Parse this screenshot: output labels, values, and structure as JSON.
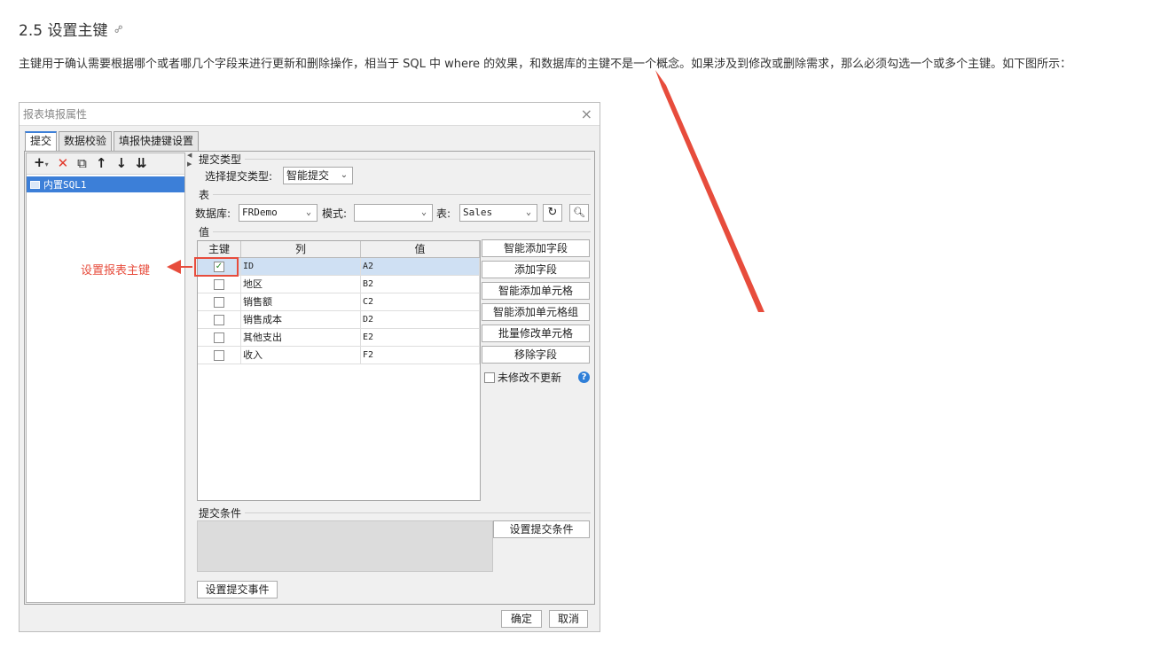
{
  "doc": {
    "section_title": "2.5 设置主键",
    "paragraph": "主键用于确认需要根据哪个或者哪几个字段来进行更新和删除操作，相当于 SQL 中 where 的效果，和数据库的主键不是一个概念。如果涉及到修改或删除需求，那么必须勾选一个或多个主键。如下图所示："
  },
  "annotation": {
    "label": "设置报表主键",
    "color": "#e74c3c"
  },
  "dialog": {
    "title": "报表填报属性",
    "close": "×",
    "tabs": [
      {
        "label": "提交",
        "active": true
      },
      {
        "label": "数据校验",
        "active": false
      },
      {
        "label": "填报快捷键设置",
        "active": false
      }
    ],
    "toolbar": {
      "add": "+",
      "add_dd": "▾",
      "delete": "✕",
      "copy": "⧉",
      "up": "↑",
      "down": "↓",
      "bottom": "⇊"
    },
    "tree": {
      "item": "内置SQL1"
    },
    "submit_type": {
      "section": "提交类型",
      "label": "选择提交类型:",
      "value": "智能提交"
    },
    "table": {
      "section": "表",
      "db_label": "数据库:",
      "db_value": "FRDemo",
      "schema_label": "模式:",
      "schema_value": "",
      "table_label": "表:",
      "table_value": "Sales"
    },
    "values": {
      "section": "值",
      "headers": {
        "pk": "主键",
        "col": "列",
        "val": "值"
      },
      "rows": [
        {
          "pk": true,
          "col": "ID",
          "val": "A2"
        },
        {
          "pk": false,
          "col": "地区",
          "val": "B2"
        },
        {
          "pk": false,
          "col": "销售额",
          "val": "C2"
        },
        {
          "pk": false,
          "col": "销售成本",
          "val": "D2"
        },
        {
          "pk": false,
          "col": "其他支出",
          "val": "E2"
        },
        {
          "pk": false,
          "col": "收入",
          "val": "F2"
        }
      ],
      "buttons": [
        "智能添加字段",
        "添加字段",
        "智能添加单元格",
        "智能添加单元格组",
        "批量修改单元格",
        "移除字段"
      ],
      "no_update_label": "未修改不更新",
      "help": "?"
    },
    "condition": {
      "section": "提交条件",
      "button": "设置提交条件"
    },
    "event_button": "设置提交事件",
    "ok": "确定",
    "cancel": "取消"
  },
  "colors": {
    "accent": "#3c7fd8",
    "annotation_red": "#e74c3c"
  }
}
